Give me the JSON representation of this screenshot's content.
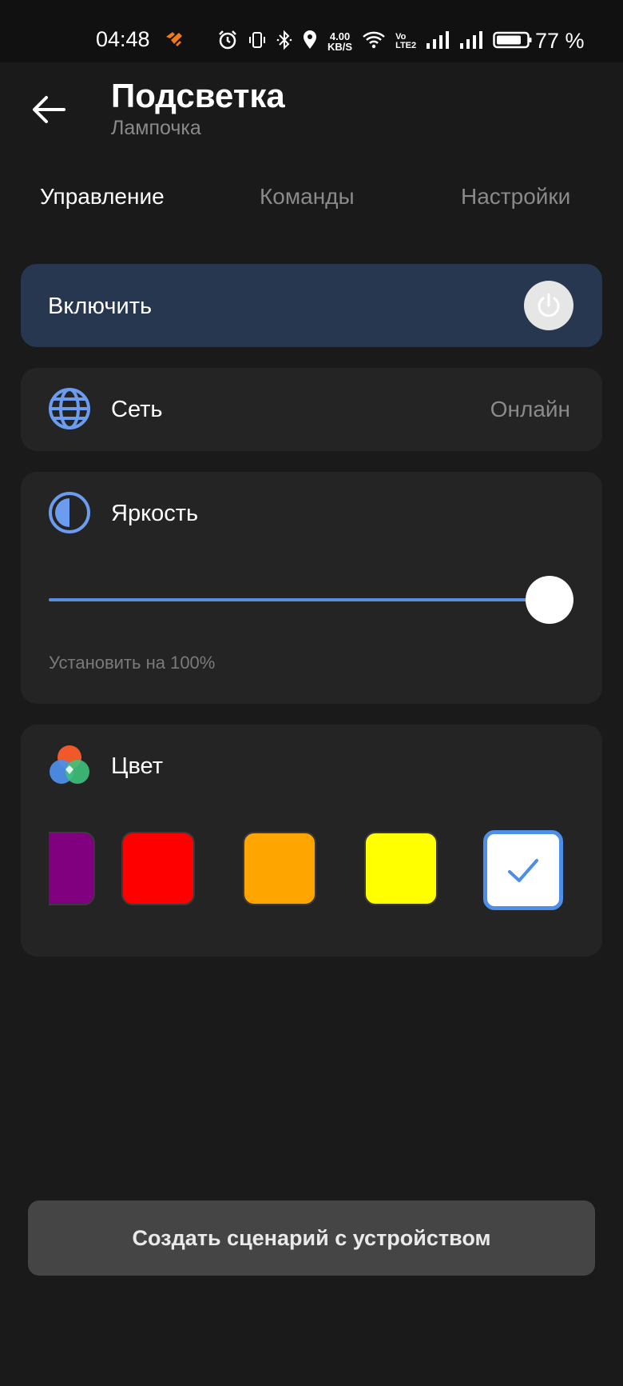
{
  "status_bar": {
    "time": "04:48",
    "speed_value": "4.00",
    "speed_unit": "KB/S",
    "volte_top": "Vo",
    "volte_bottom": "LTE2",
    "battery_percent": "77 %"
  },
  "header": {
    "title": "Подсветка",
    "subtitle": "Лампочка",
    "back_icon": "arrow-left-icon"
  },
  "tabs": [
    {
      "label": "Управление",
      "active": true
    },
    {
      "label": "Команды",
      "active": false
    },
    {
      "label": "Настройки",
      "active": false
    }
  ],
  "power": {
    "label": "Включить",
    "icon": "power-icon"
  },
  "network": {
    "label": "Сеть",
    "value": "Онлайн",
    "icon": "globe-icon"
  },
  "brightness": {
    "label": "Яркость",
    "icon": "brightness-icon",
    "level_percent": 100,
    "hint": "Установить на 100%",
    "accent": "#5a8fe0"
  },
  "color": {
    "label": "Цвет",
    "icon": "color-palette-icon",
    "swatches": [
      {
        "name": "purple",
        "hex": "#800080"
      },
      {
        "name": "red",
        "hex": "#ff0000"
      },
      {
        "name": "orange",
        "hex": "#ffa500"
      },
      {
        "name": "yellow",
        "hex": "#ffff00"
      },
      {
        "name": "white",
        "hex": "#ffffff",
        "selected": true
      }
    ],
    "selected_border": "#4d8ee8"
  },
  "actions": {
    "create_scenario": "Создать сценарий с устройством"
  }
}
